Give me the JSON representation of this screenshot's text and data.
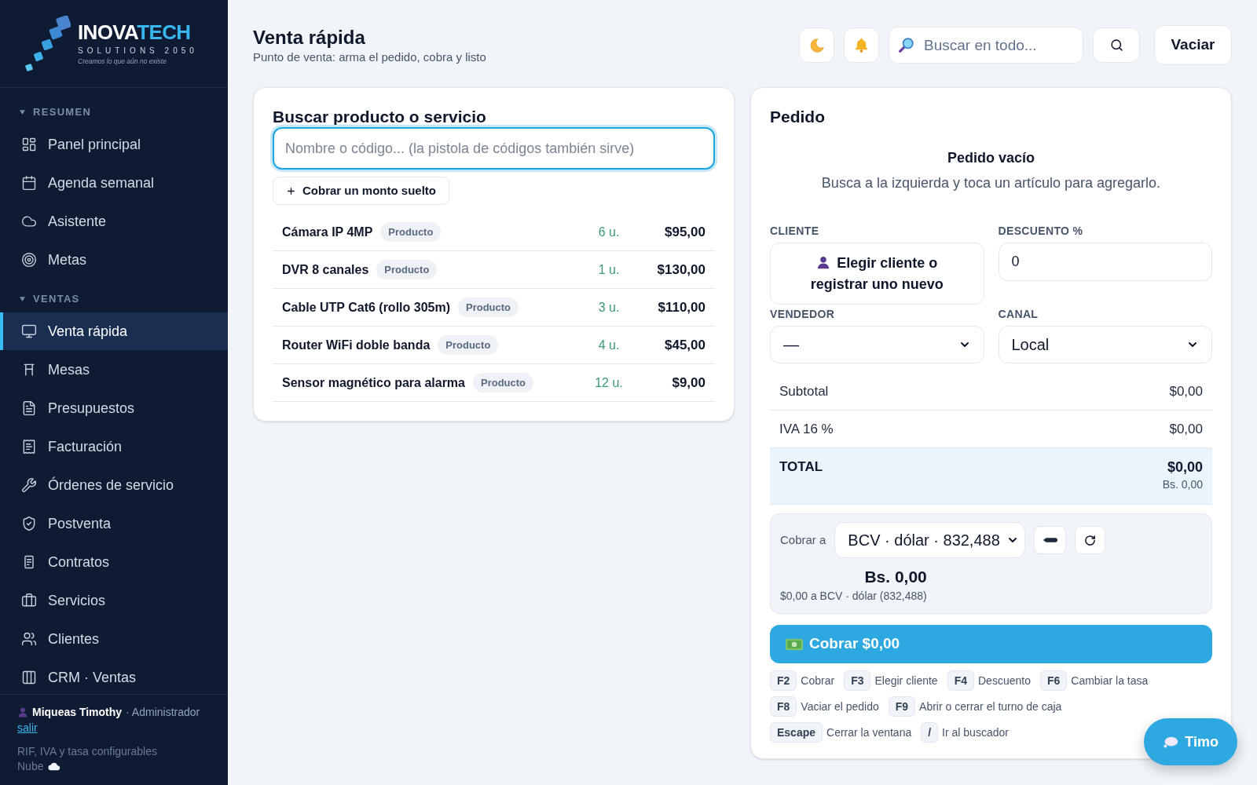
{
  "sidebar": {
    "logo": {
      "brand": "INOVA",
      "brand_accent": "TECH",
      "subtitle": "SOLUTIONS 2050",
      "tagline": "Creamos lo que aún no existe"
    },
    "sections": [
      {
        "title": "RESUMEN",
        "expanded": true,
        "items": [
          {
            "label": "Panel principal",
            "selected": false
          },
          {
            "label": "Agenda semanal",
            "selected": false
          },
          {
            "label": "Asistente",
            "selected": false
          },
          {
            "label": "Metas",
            "selected": false
          }
        ]
      },
      {
        "title": "VENTAS",
        "expanded": true,
        "items": [
          {
            "label": "Venta rápida",
            "selected": true
          },
          {
            "label": "Mesas",
            "selected": false
          },
          {
            "label": "Presupuestos",
            "selected": false
          },
          {
            "label": "Facturación",
            "selected": false
          },
          {
            "label": "Órdenes de servicio",
            "selected": false
          },
          {
            "label": "Postventa",
            "selected": false
          },
          {
            "label": "Contratos",
            "selected": false
          },
          {
            "label": "Servicios",
            "selected": false
          },
          {
            "label": "Clientes",
            "selected": false
          },
          {
            "label": "CRM · Ventas",
            "selected": false
          }
        ]
      }
    ],
    "footer": {
      "user": "Miqueas Timothy",
      "role": "· Administrador",
      "logout": "salir",
      "note": "RIF, IVA y tasa configurables",
      "storage": "Nube"
    }
  },
  "header": {
    "title": "Venta rápida",
    "subtitle": "Punto de venta: arma el pedido, cobra y listo",
    "search": {
      "placeholder": "Buscar en todo..."
    },
    "clear_button": "Vaciar"
  },
  "product_search": {
    "title": "Buscar producto o servicio",
    "search": {
      "placeholder": "Nombre o código... (la pistola de códigos también sirve)",
      "focused": true
    },
    "loose_amount_button": "Cobrar un monto suelto",
    "products": [
      {
        "name": "Cámara IP 4MP",
        "type": "Producto",
        "stock": "6 u.",
        "price": "$95,00"
      },
      {
        "name": "DVR 8 canales",
        "type": "Producto",
        "stock": "1 u.",
        "price": "$130,00"
      },
      {
        "name": "Cable UTP Cat6 (rollo 305m)",
        "type": "Producto",
        "stock": "3 u.",
        "price": "$110,00"
      },
      {
        "name": "Router WiFi doble banda",
        "type": "Producto",
        "stock": "4 u.",
        "price": "$45,00"
      },
      {
        "name": "Sensor magnético para alarma",
        "type": "Producto",
        "stock": "12 u.",
        "price": "$9,00"
      }
    ]
  },
  "order": {
    "title": "Pedido",
    "empty_title": "Pedido vacío",
    "empty_hint": "Busca a la izquierda y toca un artículo para agregarlo.",
    "client": {
      "label": "CLIENTE",
      "button": "Elegir cliente o registrar uno nuevo"
    },
    "discount": {
      "label": "DESCUENTO %",
      "value": "0"
    },
    "seller": {
      "label": "VENDEDOR",
      "value": "—"
    },
    "channel": {
      "label": "CANAL",
      "value": "Local"
    },
    "summary": [
      {
        "kind": "line",
        "label": "Subtotal",
        "value": "$0,00"
      },
      {
        "kind": "line",
        "label": "IVA 16 %",
        "value": "$0,00"
      },
      {
        "kind": "total",
        "label": "TOTAL",
        "value": "$0,00",
        "secondary": "Bs. 0,00"
      }
    ],
    "payment": {
      "label": "Cobrar a",
      "rate": "BCV · dólar · 832,488",
      "amount": "Bs. 0,00",
      "conversion": "$0,00 a BCV · dólar (832,488)"
    },
    "charge_button": "Cobrar $0,00",
    "shortcut_rows": [
      [
        {
          "key": "F2",
          "action": "Cobrar"
        },
        {
          "key": "F3",
          "action": "Elegir cliente"
        },
        {
          "key": "F4",
          "action": "Descuento"
        },
        {
          "key": "F6",
          "action": "Cambiar la tasa"
        }
      ],
      [
        {
          "key": "F8",
          "action": "Vaciar el pedido"
        },
        {
          "key": "F9",
          "action": "Abrir o cerrar el turno de caja"
        }
      ],
      [
        {
          "key": "Escape",
          "action": "Cerrar la ventana"
        },
        {
          "key": "/",
          "action": "Ir al buscador"
        }
      ]
    ]
  },
  "assistant_button": "Timo"
}
